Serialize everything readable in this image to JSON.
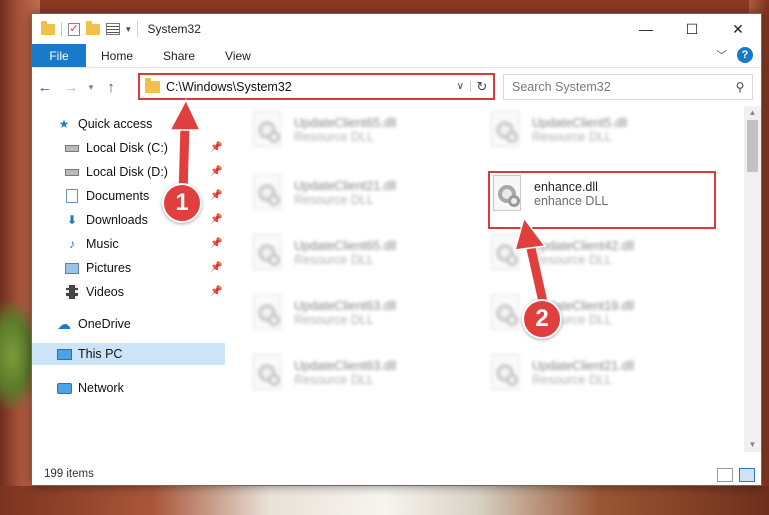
{
  "window": {
    "title": "System32",
    "minimize_glyph": "—",
    "maximize_glyph": "☐",
    "close_glyph": "✕"
  },
  "ribbon": {
    "file": "File",
    "tabs": [
      "Home",
      "Share",
      "View"
    ],
    "help_glyph": "?"
  },
  "address": {
    "path": "C:\\Windows\\System32",
    "search_placeholder": "Search System32"
  },
  "nav": {
    "items": [
      {
        "label": "Quick access",
        "icon": "star-icon"
      },
      {
        "label": "Local Disk (C:)",
        "icon": "drive-icon",
        "pinned": true
      },
      {
        "label": "Local Disk (D:)",
        "icon": "drive-icon",
        "pinned": true
      },
      {
        "label": "Documents",
        "icon": "documents-icon",
        "pinned": true
      },
      {
        "label": "Downloads",
        "icon": "download-arrow-icon",
        "pinned": true
      },
      {
        "label": "Music",
        "icon": "music-note-icon",
        "pinned": true
      },
      {
        "label": "Pictures",
        "icon": "pictures-icon",
        "pinned": true
      },
      {
        "label": "Videos",
        "icon": "film-icon",
        "pinned": true
      },
      {
        "label": "OneDrive",
        "icon": "cloud-icon"
      },
      {
        "label": "This PC",
        "icon": "monitor-icon",
        "selected": true
      },
      {
        "label": "Network",
        "icon": "network-icon"
      }
    ]
  },
  "files": [
    {
      "name": "UpdateClient65.dll",
      "type": "Resource DLL"
    },
    {
      "name": "UpdateClient5.dll",
      "type": "Resource DLL"
    },
    {
      "name": "UpdateClient21.dll",
      "type": "Resource DLL"
    },
    {
      "name": "enhance.dll",
      "type": "enhance DLL"
    },
    {
      "name": "UpdateClient65.dll",
      "type": "Resource DLL"
    },
    {
      "name": "UpdateClient42.dll",
      "type": "Resource DLL"
    },
    {
      "name": "UpdateClient63.dll",
      "type": "Resource DLL"
    },
    {
      "name": "UpdateClient19.dll",
      "type": "Resource DLL"
    },
    {
      "name": "UpdateClient63.dll",
      "type": "Resource DLL"
    },
    {
      "name": "UpdateClient21.dll",
      "type": "Resource DLL"
    }
  ],
  "status": {
    "item_count": "199 items"
  },
  "annotations": {
    "step1": "1",
    "step2": "2",
    "color": "#d93a3a"
  }
}
